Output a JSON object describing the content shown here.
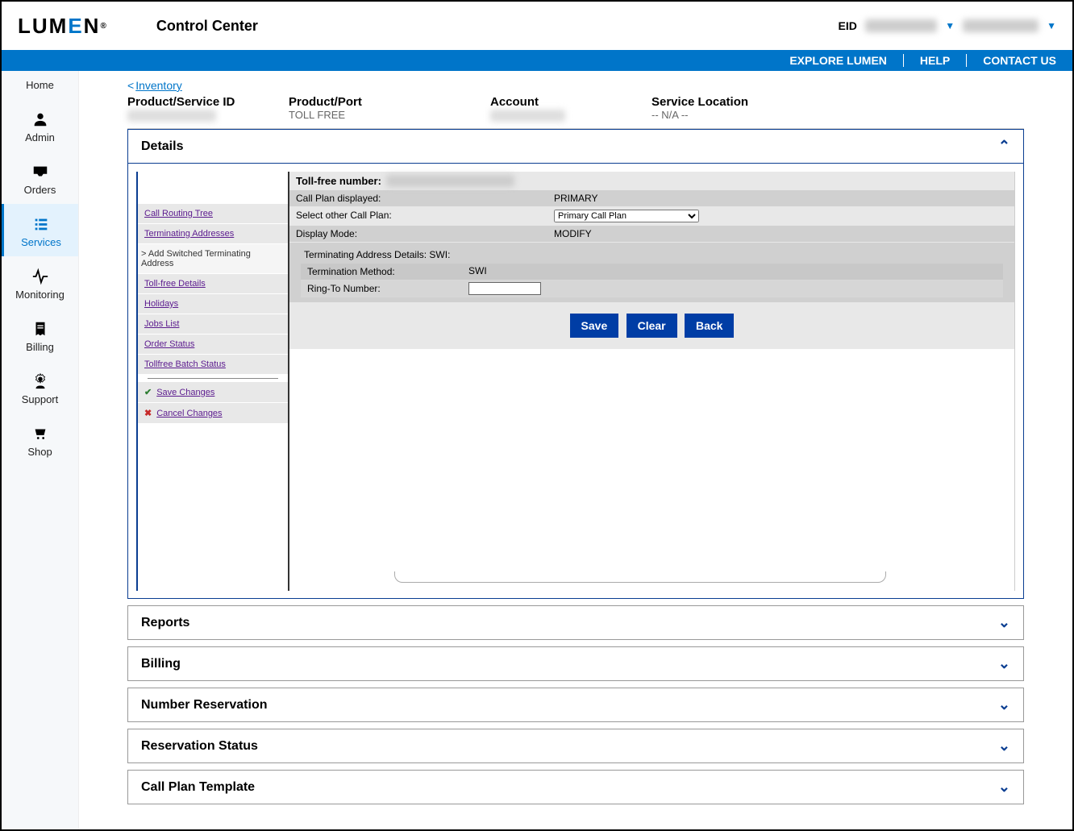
{
  "header": {
    "logo_text_pre": "LUM",
    "logo_text_e": "E",
    "logo_text_post": "N",
    "logo_reg": "®",
    "app_title": "Control Center",
    "eid_label": "EID",
    "eid_value": "XXXXXXX",
    "user_value": "xxxxxxxxxx"
  },
  "bluebar": {
    "explore": "EXPLORE LUMEN",
    "help": "HELP",
    "contact": "CONTACT US"
  },
  "nav": {
    "home": "Home",
    "admin": "Admin",
    "orders": "Orders",
    "services": "Services",
    "monitoring": "Monitoring",
    "billing": "Billing",
    "support": "Support",
    "shop": "Shop"
  },
  "breadcrumb": {
    "back_label": "Inventory"
  },
  "info": {
    "product_service_id": {
      "label": "Product/Service ID",
      "value": "XXXXXXXXX"
    },
    "product_port": {
      "label": "Product/Port",
      "value": "TOLL FREE"
    },
    "account": {
      "label": "Account",
      "value": "XXXXXXX"
    },
    "service_location": {
      "label": "Service Location",
      "value": "-- N/A --"
    }
  },
  "panels": {
    "details": "Details",
    "reports": "Reports",
    "billing": "Billing",
    "number_reservation": "Number Reservation",
    "reservation_status": "Reservation Status",
    "call_plan_template": "Call Plan Template"
  },
  "sidemenu": {
    "call_routing_tree": "Call Routing Tree",
    "terminating_addresses": "Terminating Addresses",
    "add_switched": "Add Switched Terminating Address",
    "tollfree_details": "Toll-free Details",
    "holidays": "Holidays",
    "jobs_list": "Jobs List",
    "order_status": "Order Status",
    "tollfree_batch_status": "Tollfree Batch Status",
    "save_changes": "Save Changes",
    "cancel_changes": "Cancel Changes"
  },
  "detail": {
    "tollfree_number_label": "Toll-free number:",
    "tollfree_number_value": "XXXXXXX XXXX",
    "call_plan_displayed_label": "Call Plan displayed:",
    "call_plan_displayed_value": "PRIMARY",
    "select_other_label": "Select other Call Plan:",
    "select_other_option": "Primary Call Plan",
    "display_mode_label": "Display Mode:",
    "display_mode_value": "MODIFY",
    "term_details_title": "Terminating Address Details: SWI:",
    "term_method_label": "Termination Method:",
    "term_method_value": "SWI",
    "ring_to_label": "Ring-To Number:",
    "ring_to_value": ""
  },
  "buttons": {
    "save": "Save",
    "clear": "Clear",
    "back": "Back"
  }
}
